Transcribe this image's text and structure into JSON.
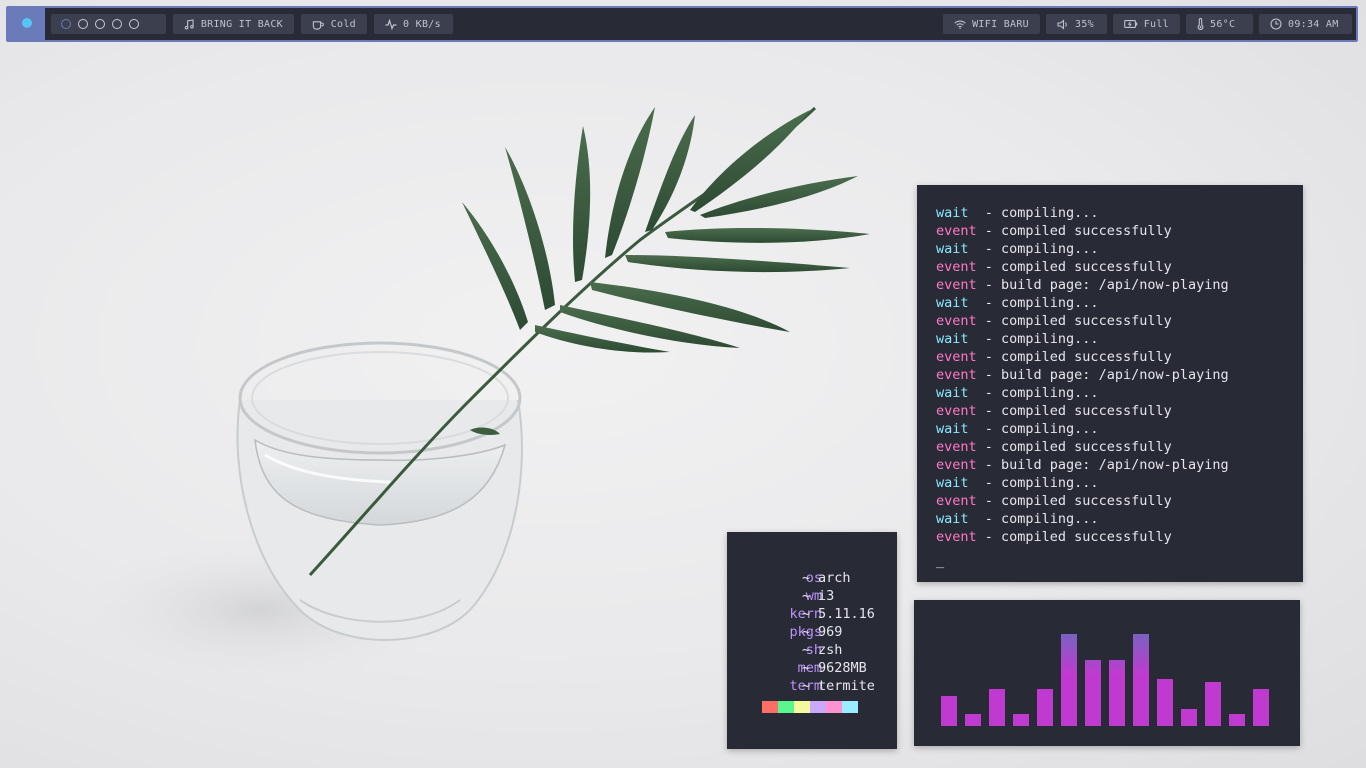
{
  "bar": {
    "workspaces": [
      {
        "name": "workspace-1",
        "active": true
      },
      {
        "name": "workspace-2",
        "active": false
      },
      {
        "name": "workspace-3",
        "active": false
      },
      {
        "name": "workspace-4",
        "active": false
      },
      {
        "name": "workspace-5",
        "active": false
      }
    ],
    "music": "BRING IT BACK",
    "weather": "Cold",
    "network_speed": "0 KB/s",
    "wifi": "WIFI BARU",
    "volume": "35%",
    "battery": "Full",
    "temperature": "56°C",
    "clock": "09:34 AM",
    "colors": {
      "border": "#6b7ab8",
      "background": "#282a36",
      "module": "#3c3f4e",
      "launcher": "#55c5f5"
    }
  },
  "log": {
    "lines": [
      {
        "key": "wait",
        "msg": "compiling..."
      },
      {
        "key": "event",
        "msg": "compiled successfully"
      },
      {
        "key": "wait",
        "msg": "compiling..."
      },
      {
        "key": "event",
        "msg": "compiled successfully"
      },
      {
        "key": "event",
        "msg": "build page: /api/now-playing"
      },
      {
        "key": "wait",
        "msg": "compiling..."
      },
      {
        "key": "event",
        "msg": "compiled successfully"
      },
      {
        "key": "wait",
        "msg": "compiling..."
      },
      {
        "key": "event",
        "msg": "compiled successfully"
      },
      {
        "key": "event",
        "msg": "build page: /api/now-playing"
      },
      {
        "key": "wait",
        "msg": "compiling..."
      },
      {
        "key": "event",
        "msg": "compiled successfully"
      },
      {
        "key": "wait",
        "msg": "compiling..."
      },
      {
        "key": "event",
        "msg": "compiled successfully"
      },
      {
        "key": "event",
        "msg": "build page: /api/now-playing"
      },
      {
        "key": "wait",
        "msg": "compiling..."
      },
      {
        "key": "event",
        "msg": "compiled successfully"
      },
      {
        "key": "wait",
        "msg": "compiling..."
      },
      {
        "key": "event",
        "msg": "compiled successfully"
      }
    ],
    "cursor": "_",
    "colors": {
      "wait": "#8be9fd",
      "event": "#ff79c6"
    }
  },
  "fetch": {
    "rows": [
      {
        "label": "os",
        "value": "arch"
      },
      {
        "label": "wm",
        "value": "i3"
      },
      {
        "label": "kern",
        "value": "5.11.16"
      },
      {
        "label": "pkgs",
        "value": "969"
      },
      {
        "label": "sh",
        "value": "zsh"
      },
      {
        "label": "mem",
        "value": "9628MB"
      },
      {
        "label": "term",
        "value": "termite"
      }
    ],
    "separator": "~",
    "swatches": [
      "#ff6e67",
      "#5af78e",
      "#f4f99d",
      "#caa9fa",
      "#ff92d0",
      "#9aedfe"
    ]
  },
  "visualizer": {
    "levels": [
      0.33,
      0.13,
      0.4,
      0.13,
      0.4,
      1.0,
      0.72,
      0.72,
      1.0,
      0.51,
      0.19,
      0.48,
      0.13,
      0.4
    ],
    "gradient": [
      "#c13ad0",
      "#7a62c0"
    ]
  }
}
